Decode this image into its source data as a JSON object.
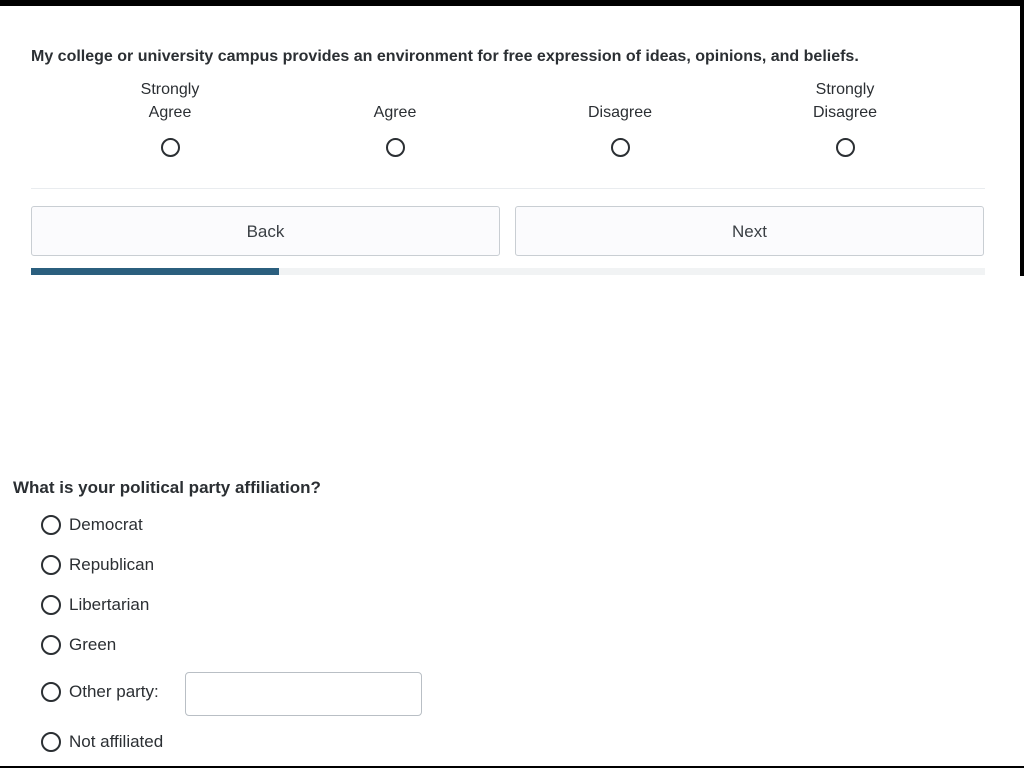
{
  "likert": {
    "question": "My college or university campus provides an environment for free expression of ideas, opinions, and beliefs.",
    "options": [
      {
        "label_line1": "Strongly",
        "label_line2": "Agree"
      },
      {
        "label_line1": "",
        "label_line2": "Agree"
      },
      {
        "label_line1": "",
        "label_line2": "Disagree"
      },
      {
        "label_line1": "Strongly",
        "label_line2": "Disagree"
      }
    ]
  },
  "navigation": {
    "back_label": "Back",
    "next_label": "Next"
  },
  "progress": {
    "fraction": 0.26,
    "fill_color": "#2b5f7e"
  },
  "party": {
    "question": "What is your political party affiliation?",
    "options": [
      {
        "label": "Democrat"
      },
      {
        "label": "Republican"
      },
      {
        "label": "Libertarian"
      },
      {
        "label": "Green"
      },
      {
        "label": "Other party:"
      },
      {
        "label": "Not affiliated"
      }
    ],
    "other_input_value": ""
  }
}
